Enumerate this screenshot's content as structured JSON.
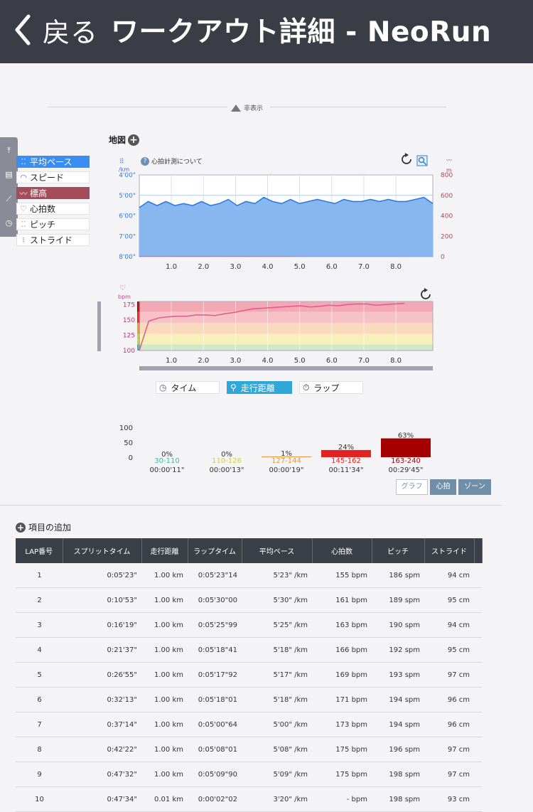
{
  "header": {
    "back_label": "戻る",
    "title": "ワークアウト詳細 - NeoRun"
  },
  "collapse_label": "非表示",
  "side_tabs": [
    "top-icon",
    "memo-icon",
    "graph-icon",
    "stopwatch-icon"
  ],
  "legend": [
    {
      "label": "平均ペース",
      "icon": "feet-icon",
      "state": "on-blue"
    },
    {
      "label": "スピード",
      "icon": "speedometer-icon",
      "state": ""
    },
    {
      "label": "標高",
      "icon": "elevation-icon",
      "state": "on-red"
    },
    {
      "label": "心拍数",
      "icon": "heart-icon",
      "state": ""
    },
    {
      "label": "ピッチ",
      "icon": "footsteps-icon",
      "state": ""
    },
    {
      "label": "ストライド",
      "icon": "stride-icon",
      "state": ""
    }
  ],
  "map_label": "地図",
  "hr_about": "心拍計測について",
  "chart_data": [
    {
      "type": "line",
      "title": "",
      "left_axis": {
        "unit": "/km",
        "ticks": [
          "4'00\"",
          "5'00\"",
          "6'00\"",
          "7'00\"",
          "8'00\""
        ]
      },
      "right_axis": {
        "unit": "m",
        "ticks": [
          "800",
          "600",
          "400",
          "200",
          "0"
        ]
      },
      "x_ticks": [
        "1.0",
        "2.0",
        "3.0",
        "4.0",
        "5.0",
        "6.0",
        "7.0",
        "8.0"
      ],
      "series": [
        {
          "values": [
            5.6,
            5.3,
            5.5,
            5.3,
            5.5,
            5.4,
            5.5,
            5.3,
            5.5,
            5.4,
            5.2,
            5.5,
            5.3,
            5.4,
            5.1,
            5.3,
            5.4,
            5.2,
            5.4,
            5.3,
            5.2,
            5.3,
            5.4,
            5.2,
            5.3,
            5.3,
            5.2,
            5.3,
            5.2,
            5.3,
            5.3,
            5.2,
            5.1,
            5.4
          ]
        },
        {
          "values": [
            5,
            5,
            6,
            6,
            5,
            5,
            4,
            4,
            3,
            3,
            3,
            3,
            3,
            2,
            2
          ]
        }
      ]
    },
    {
      "type": "line",
      "title": "",
      "unit": "bpm",
      "y_ticks": [
        "175",
        "150",
        "125",
        "100"
      ],
      "ylim": [
        100,
        180
      ],
      "x_ticks": [
        "1.0",
        "2.0",
        "3.0",
        "4.0",
        "5.0",
        "6.0",
        "7.0",
        "8.0"
      ],
      "series": [
        {
          "values": [
            100,
            148,
            153,
            155,
            156,
            156,
            158,
            158,
            157,
            160,
            162,
            165,
            168,
            169,
            170,
            171,
            172,
            173,
            171,
            172,
            174,
            173,
            175,
            176,
            176,
            174,
            175,
            176,
            177
          ]
        }
      ]
    },
    {
      "type": "bar",
      "title": "",
      "y_ticks": [
        "100",
        "50",
        "0"
      ],
      "ylim": [
        0,
        100
      ],
      "categories": [
        "30-110",
        "110-126",
        "127-144",
        "145-162",
        "163-240"
      ],
      "values": [
        0,
        0,
        1,
        24,
        63
      ],
      "labels": [
        "0%",
        "0%",
        "1%",
        "24%",
        "63%"
      ],
      "times": [
        "00:00'11\"",
        "00:00'13\"",
        "00:00'19\"",
        "00:11'34\"",
        "00:29'45\""
      ],
      "colors": [
        "#47b8a3",
        "#c8d14e",
        "#e8963a",
        "#e32222",
        "#a50000"
      ]
    }
  ],
  "x_modes": [
    {
      "label": "タイム",
      "icon": "clock-icon",
      "active": false
    },
    {
      "label": "走行距離",
      "icon": "distance-icon",
      "active": true
    },
    {
      "label": "ラップ",
      "icon": "lap-icon",
      "active": false
    }
  ],
  "zone_buttons": [
    {
      "label": "グラフ",
      "active": false
    },
    {
      "label": "心拍",
      "active": true
    },
    {
      "label": "ゾーン",
      "active": true
    }
  ],
  "add_item_label": "項目の追加",
  "table": {
    "headers": [
      "LAP番号",
      "スプリットタイム",
      "走行距離",
      "ラップタイム",
      "平均ペース",
      "心拍数",
      "ピッチ",
      "ストライド"
    ],
    "rows": [
      [
        "1",
        "0:05'23\"",
        "1.00 km",
        "0:05'23\"14",
        "5'23\" /km",
        "155 bpm",
        "186 spm",
        "94 cm"
      ],
      [
        "2",
        "0:10'53\"",
        "1.00 km",
        "0:05'30\"00",
        "5'30\" /km",
        "161 bpm",
        "189 spm",
        "95 cm"
      ],
      [
        "3",
        "0:16'19\"",
        "1.00 km",
        "0:05'25\"99",
        "5'25\" /km",
        "163 bpm",
        "190 spm",
        "94 cm"
      ],
      [
        "4",
        "0:21'37\"",
        "1.00 km",
        "0:05'18\"41",
        "5'18\" /km",
        "166 bpm",
        "192 spm",
        "95 cm"
      ],
      [
        "5",
        "0:26'55\"",
        "1.00 km",
        "0:05'17\"92",
        "5'17\" /km",
        "169 bpm",
        "193 spm",
        "97 cm"
      ],
      [
        "6",
        "0:32'13\"",
        "1.00 km",
        "0:05'18\"01",
        "5'18\" /km",
        "171 bpm",
        "194 spm",
        "96 cm"
      ],
      [
        "7",
        "0:37'14\"",
        "1.00 km",
        "0:05'00\"64",
        "5'00\" /km",
        "173 bpm",
        "194 spm",
        "96 cm"
      ],
      [
        "8",
        "0:42'22\"",
        "1.00 km",
        "0:05'08\"01",
        "5'08\" /km",
        "175 bpm",
        "196 spm",
        "97 cm"
      ],
      [
        "9",
        "0:47'32\"",
        "1.00 km",
        "0:05'09\"90",
        "5'09\" /km",
        "175 bpm",
        "198 spm",
        "97 cm"
      ],
      [
        "10",
        "0:47'34\"",
        "0.01 km",
        "0:00'02\"02",
        "3'20\" /km",
        "- bpm",
        "198 spm",
        "93 cm"
      ]
    ]
  }
}
